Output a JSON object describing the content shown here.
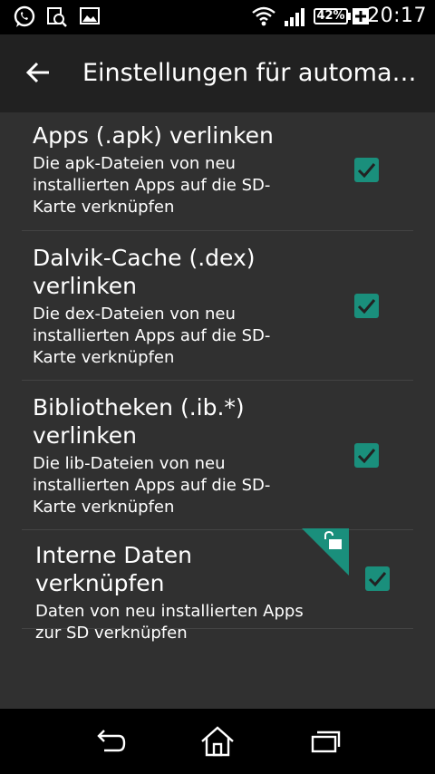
{
  "status_bar": {
    "time": "20:17",
    "battery_percent": "42%",
    "icons": [
      "whatsapp-icon",
      "search-document-icon",
      "image-icon",
      "wifi-icon",
      "signal-icon",
      "battery-icon",
      "charging-plus-icon"
    ]
  },
  "app_bar": {
    "title": "Einstellungen für automatische Verknüpfung",
    "back_icon": "arrow-left-icon"
  },
  "settings": [
    {
      "title": "Apps (.apk) verlinken",
      "summary": "Die apk-Dateien von neu installierten Apps auf die SD-Karte verknüpfen",
      "checked": true
    },
    {
      "title": "Dalvik-Cache (.dex) verlinken",
      "summary": "Die dex-Dateien von neu installierten Apps auf die SD-Karte verknüpfen",
      "checked": true
    },
    {
      "title": "Bibliotheken (.ib.*) verlinken",
      "summary": "Die lib-Dateien von neu installierten Apps auf die SD-Karte verknüpfen",
      "checked": true
    },
    {
      "title": "Interne Daten verknüpfen",
      "summary": "Daten von neu installierten Apps zur SD verknüpfen",
      "checked": true,
      "badge": "unlock-icon"
    }
  ],
  "nav_bar": {
    "buttons": [
      "back-icon",
      "home-icon",
      "recent-apps-icon"
    ]
  },
  "colors": {
    "accent": "#1a8f7c",
    "background": "#303030",
    "app_bar": "#212121",
    "system_bars": "#000000"
  }
}
